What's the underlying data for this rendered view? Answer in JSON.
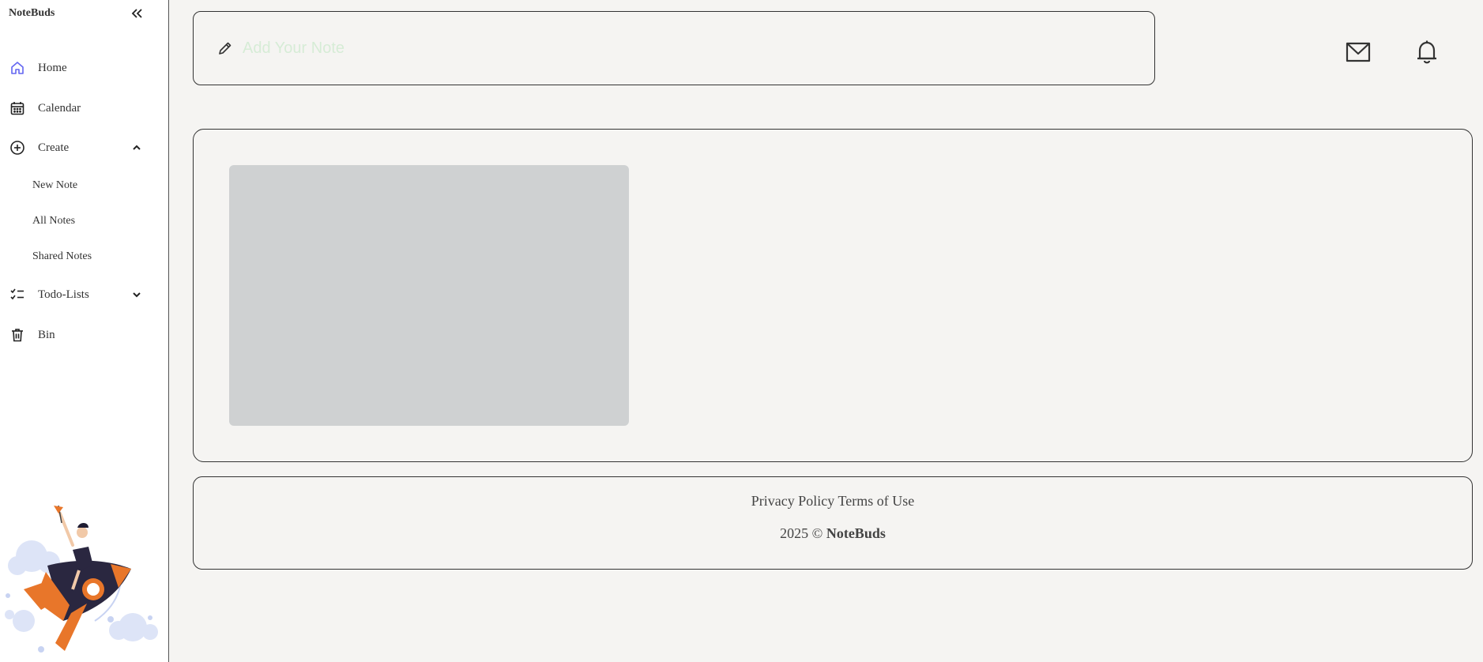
{
  "app": {
    "brand": "NoteBuds"
  },
  "sidebar": {
    "items": [
      {
        "label": "Home",
        "icon": "home-icon"
      },
      {
        "label": "Calendar",
        "icon": "calendar-icon"
      },
      {
        "label": "Create",
        "icon": "plus-circle-icon"
      },
      {
        "label": "Todo-Lists",
        "icon": "checklist-icon"
      },
      {
        "label": "Bin",
        "icon": "trash-icon"
      }
    ],
    "create_subitems": [
      "New Note",
      "All Notes",
      "Shared Notes"
    ]
  },
  "note_input": {
    "placeholder": "Add Your Note",
    "value": ""
  },
  "header_icons": [
    "mail-icon",
    "bell-icon"
  ],
  "footer": {
    "privacy": "Privacy Policy",
    "terms": "Terms of Use",
    "year": "2025 ©",
    "brand": "NoteBuds"
  },
  "colors": {
    "accent": "#6366f1",
    "background": "#f5f4f2",
    "placeholder": "#d6ecd6",
    "card": "#cfd1d2"
  }
}
